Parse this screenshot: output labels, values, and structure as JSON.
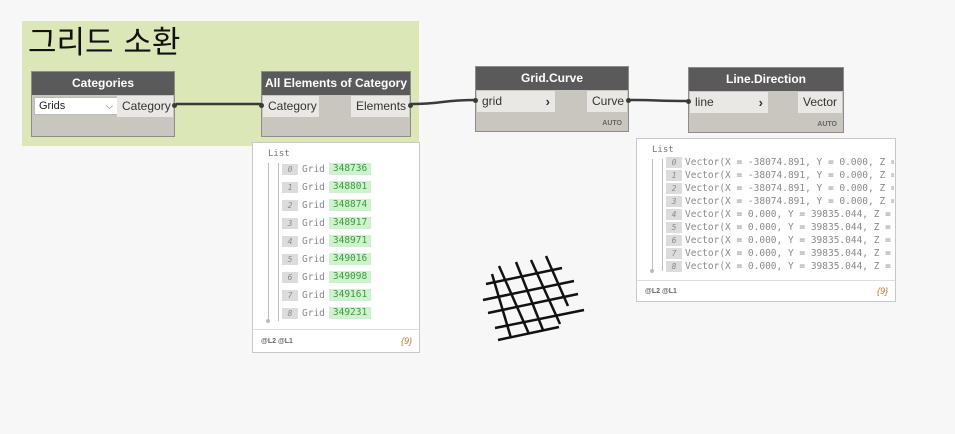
{
  "group": {
    "title": "그리드 소환"
  },
  "nodes": {
    "categories": {
      "title": "Categories",
      "dropdown_value": "Grids",
      "output": "Category"
    },
    "all_elements": {
      "title": "All Elements of Category",
      "input": "Category",
      "output": "Elements"
    },
    "grid_curve": {
      "title": "Grid.Curve",
      "input": "grid",
      "output": "Curve",
      "lacing": "AUTO"
    },
    "line_direction": {
      "title": "Line.Direction",
      "input": "line",
      "output": "Vector",
      "lacing": "AUTO"
    }
  },
  "preview_elements": {
    "title": "List",
    "items": [
      {
        "index": "0",
        "type": "Grid",
        "value": "348736"
      },
      {
        "index": "1",
        "type": "Grid",
        "value": "348801"
      },
      {
        "index": "2",
        "type": "Grid",
        "value": "348874"
      },
      {
        "index": "3",
        "type": "Grid",
        "value": "348917"
      },
      {
        "index": "4",
        "type": "Grid",
        "value": "348971"
      },
      {
        "index": "5",
        "type": "Grid",
        "value": "349016"
      },
      {
        "index": "6",
        "type": "Grid",
        "value": "349098"
      },
      {
        "index": "7",
        "type": "Grid",
        "value": "349161"
      },
      {
        "index": "8",
        "type": "Grid",
        "value": "349231"
      }
    ],
    "levels": "@L2 @L1",
    "count": "{9}"
  },
  "preview_vectors": {
    "title": "List",
    "items": [
      {
        "index": "0",
        "value": "Vector(X = -38074.891, Y = 0.000, Z ="
      },
      {
        "index": "1",
        "value": "Vector(X = -38074.891, Y = 0.000, Z ="
      },
      {
        "index": "2",
        "value": "Vector(X = -38074.891, Y = 0.000, Z ="
      },
      {
        "index": "3",
        "value": "Vector(X = -38074.891, Y = 0.000, Z ="
      },
      {
        "index": "4",
        "value": "Vector(X = 0.000, Y = 39835.044, Z ="
      },
      {
        "index": "5",
        "value": "Vector(X = 0.000, Y = 39835.044, Z ="
      },
      {
        "index": "6",
        "value": "Vector(X = 0.000, Y = 39835.044, Z ="
      },
      {
        "index": "7",
        "value": "Vector(X = 0.000, Y = 39835.044, Z ="
      },
      {
        "index": "8",
        "value": "Vector(X = 0.000, Y = 39835.044, Z ="
      }
    ],
    "levels": "@L2 @L1",
    "count": "{9}"
  },
  "colors": {
    "group_bg": "#dce7b8",
    "node_header": "#5a5a5a",
    "node_body": "#c9c6c0",
    "wire": "#3a3a3a",
    "value_bg": "#cdf2cd",
    "value_text": "#3f9a3f"
  },
  "icons": {
    "dropdown": "chevron-down-icon",
    "port_arrow": "chevron-right-icon"
  },
  "background_geometry": "grid-lines-preview"
}
